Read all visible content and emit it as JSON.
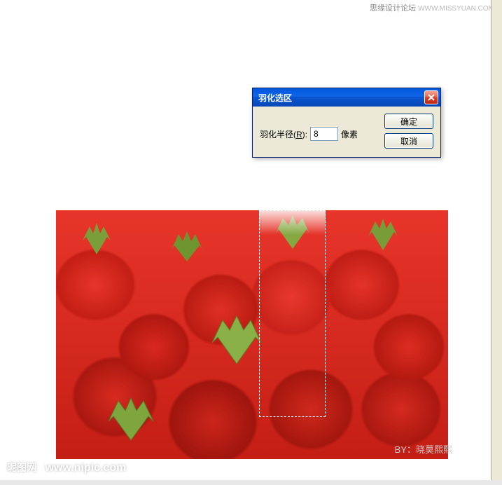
{
  "watermark_top": {
    "cn": "思缘设计论坛",
    "en": "WWW.MISSYUAN.COM"
  },
  "dialog": {
    "title": "羽化选区",
    "radius_label_prefix": "羽化半径(",
    "radius_hotkey": "R",
    "radius_label_suffix": "):",
    "radius_value": "8",
    "unit": "像素",
    "ok_label": "确定",
    "cancel_label": "取消"
  },
  "bottom_watermark": {
    "cn": "昵图网",
    "en": "www.nipic.com"
  },
  "by_text": "BY：晓莫熙熙"
}
